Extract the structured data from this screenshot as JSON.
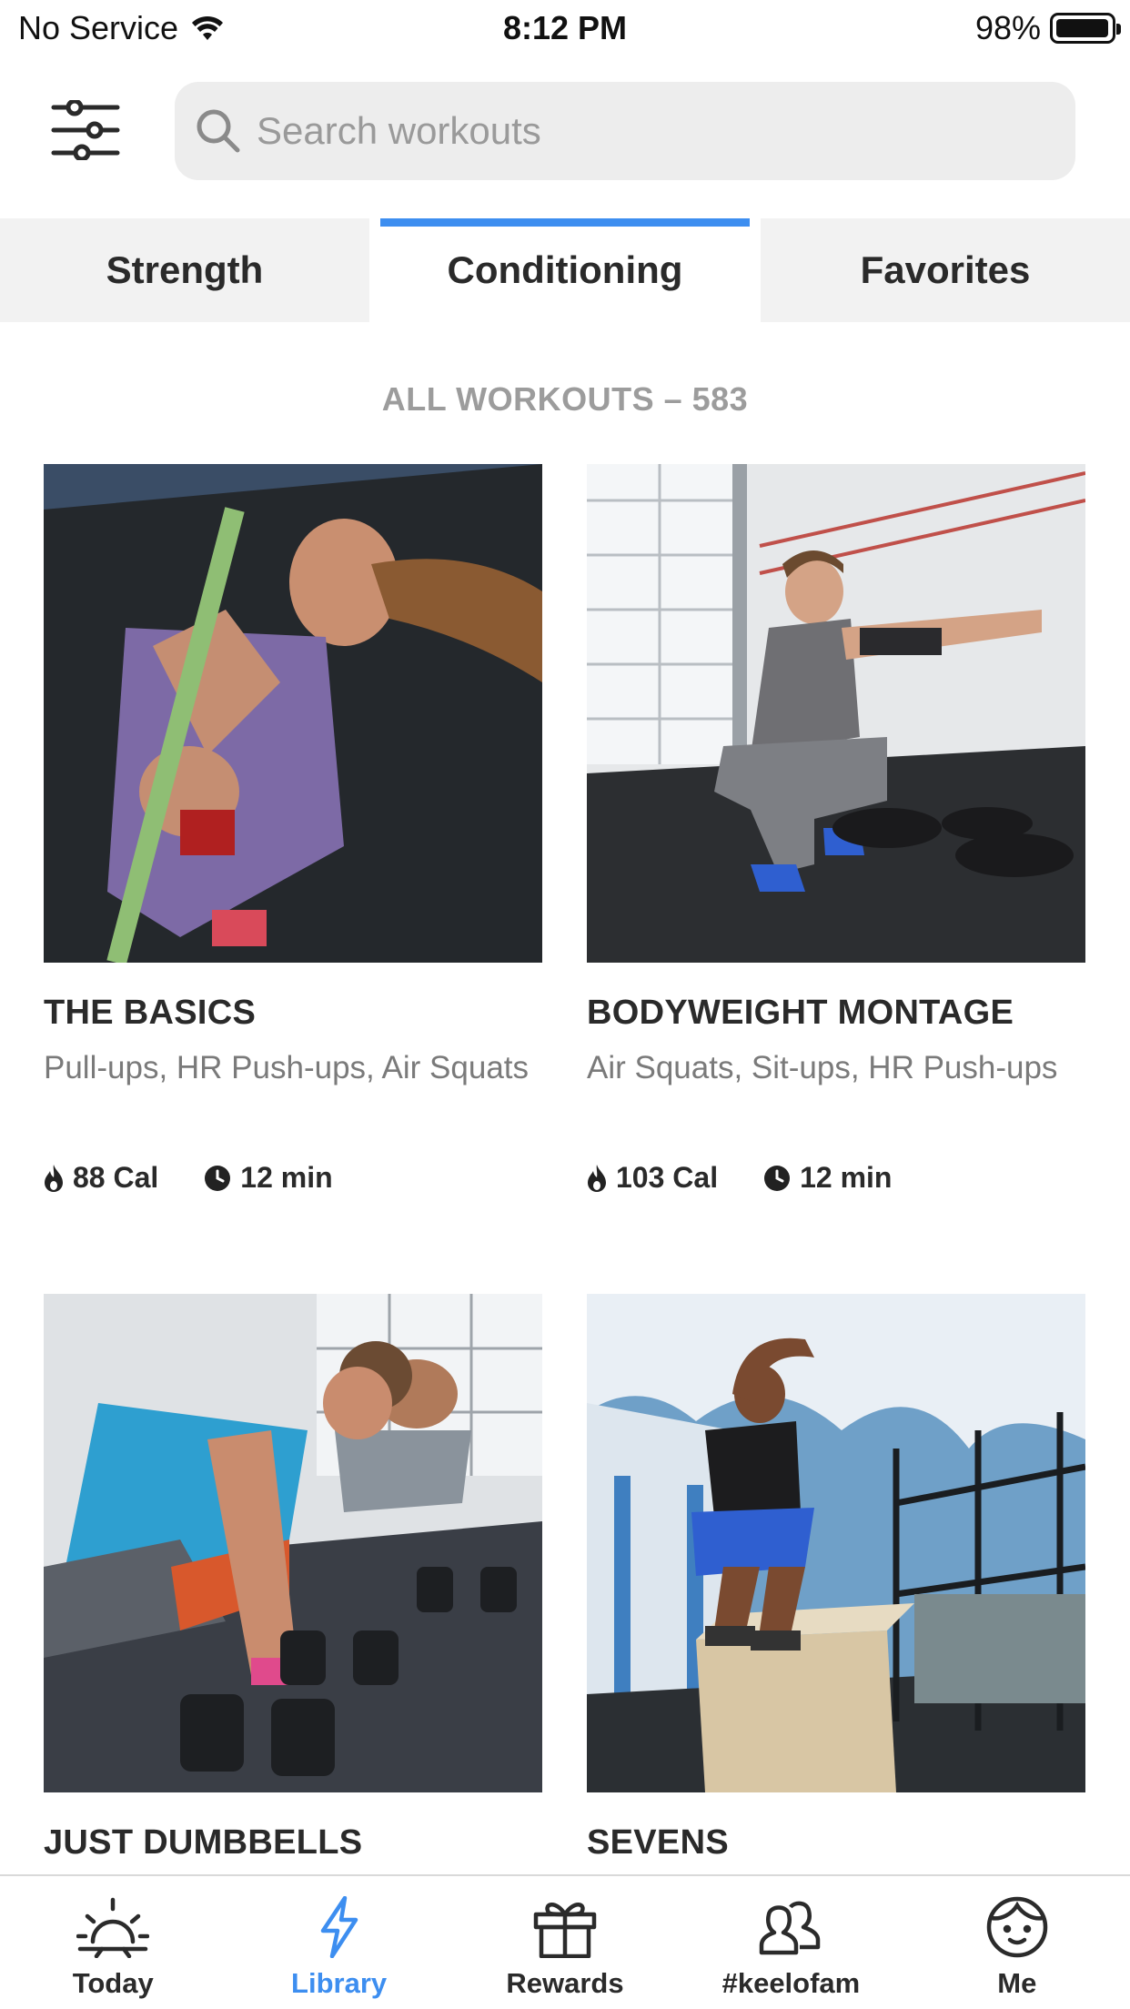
{
  "status_bar": {
    "carrier": "No Service",
    "time": "8:12 PM",
    "battery": "98%",
    "battery_level": 0.98
  },
  "header": {
    "filter_icon": "sliders-icon",
    "search": {
      "placeholder": "Search workouts",
      "value": ""
    }
  },
  "tabs": [
    {
      "label": "Strength",
      "active": false
    },
    {
      "label": "Conditioning",
      "active": true
    },
    {
      "label": "Favorites",
      "active": false
    }
  ],
  "section_heading": "ALL WORKOUTS – 583",
  "workouts": [
    {
      "title": "THE BASICS",
      "subtitle": "Pull-ups, HR Push-ups, Air Squats",
      "calories": "88 Cal",
      "duration": "12 min"
    },
    {
      "title": "BODYWEIGHT MONTAGE",
      "subtitle": "Air Squats, Sit-ups, HR Push-ups",
      "calories": "103 Cal",
      "duration": "12 min"
    },
    {
      "title": "JUST DUMBBELLS"
    },
    {
      "title": "SEVENS"
    }
  ],
  "bottom_nav": [
    {
      "label": "Today",
      "icon": "sunrise-icon",
      "active": false
    },
    {
      "label": "Library",
      "icon": "lightning-icon",
      "active": true
    },
    {
      "label": "Rewards",
      "icon": "gift-icon",
      "active": false
    },
    {
      "label": "#keelofam",
      "icon": "people-icon",
      "active": false
    },
    {
      "label": "Me",
      "icon": "face-icon",
      "active": false
    }
  ],
  "colors": {
    "accent": "#3d8ef0",
    "tab_bg": "#f2f2f2",
    "search_bg": "#ededed"
  }
}
